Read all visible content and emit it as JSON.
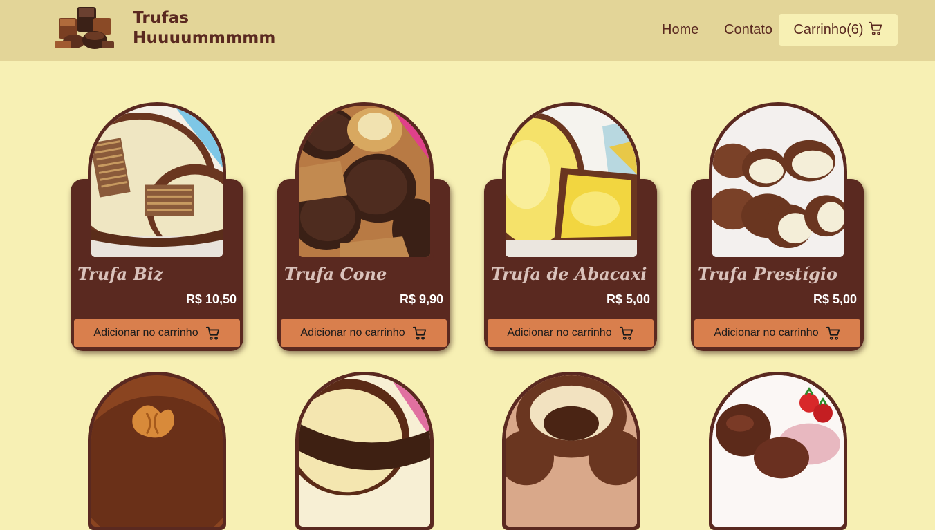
{
  "header": {
    "brand_line1": "Trufas",
    "brand_line2": "Huuuummmmm",
    "logo_icon": "chocolate-truffles-logo",
    "nav": {
      "home": "Home",
      "contato": "Contato"
    },
    "cart": {
      "label": "Carrinho",
      "count": "(6)",
      "icon": "cart-icon"
    }
  },
  "products": [
    {
      "name": "Trufa Biz",
      "price": "R$ 10,50",
      "button": "Adicionar no carrinho",
      "image": "trufa-biz-photo"
    },
    {
      "name": "Trufa Cone",
      "price": "R$ 9,90",
      "button": "Adicionar no carrinho",
      "image": "trufa-cone-photo"
    },
    {
      "name": "Trufa de Abacaxi",
      "price": "R$ 5,00",
      "button": "Adicionar no carrinho",
      "image": "trufa-abacaxi-photo"
    },
    {
      "name": "Trufa Prestígio",
      "price": "R$ 5,00",
      "button": "Adicionar no carrinho",
      "image": "trufa-prestigio-photo"
    }
  ],
  "colors": {
    "background": "#f7f0b4",
    "header": "#e3d598",
    "card": "#5a2920",
    "button": "#d97f4d",
    "brand_text": "#5a2920"
  }
}
